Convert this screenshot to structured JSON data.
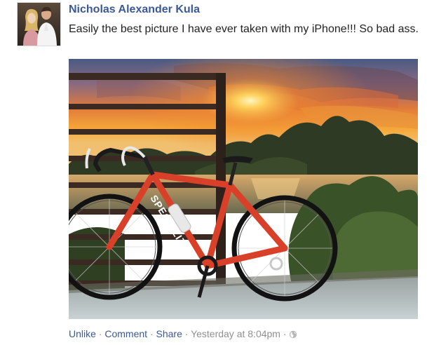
{
  "post": {
    "author_name": "Nicholas Alexander Kula",
    "message": "Easily the best picture I have ever taken with my iPhone!!! So bad ass.",
    "bike_brand_text": "SPECIALIZED"
  },
  "actions": {
    "unlike_label": "Unlike",
    "comment_label": "Comment",
    "share_label": "Share",
    "timestamp": "Yesterday at 8:04pm",
    "separator": "·",
    "privacy_icon": "globe-icon"
  },
  "colors": {
    "link": "#3b5998",
    "meta": "#909090",
    "text": "#222222"
  }
}
